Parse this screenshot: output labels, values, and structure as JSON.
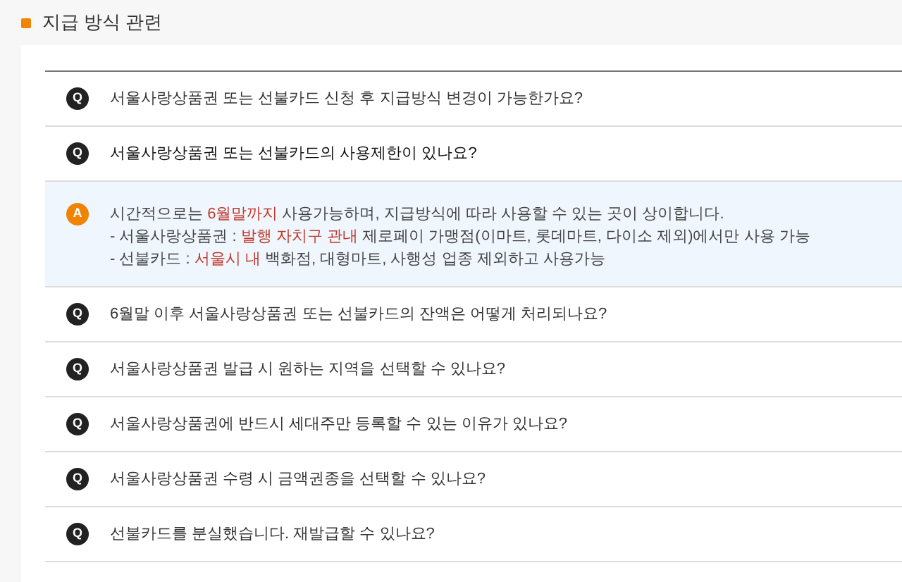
{
  "section_title": "지급 방식 관련",
  "faq": [
    {
      "badge": "Q",
      "question": "서울사랑상품권 또는 선불카드 신청 후 지급방식 변경이 가능한가요?",
      "expanded": false
    },
    {
      "badge": "Q",
      "question": "서울사랑상품권 또는 선불카드의 사용제한이 있나요?",
      "expanded": true,
      "answer": {
        "badge": "A",
        "lines": [
          [
            {
              "text": "시간적으로는 ",
              "highlight": false
            },
            {
              "text": "6월말까지",
              "highlight": true
            },
            {
              "text": " 사용가능하며, 지급방식에 따라 사용할 수 있는 곳이 상이합니다.",
              "highlight": false
            }
          ],
          [
            {
              "text": "- 서울사랑상품권 : ",
              "highlight": false
            },
            {
              "text": "발행 자치구 관내",
              "highlight": true
            },
            {
              "text": " 제로페이 가맹점(이마트, 롯데마트, 다이소 제외)에서만 사용 가능",
              "highlight": false
            }
          ],
          [
            {
              "text": "- 선불카드 : ",
              "highlight": false
            },
            {
              "text": "서울시 내",
              "highlight": true
            },
            {
              "text": " 백화점, 대형마트, 사행성 업종 제외하고 사용가능",
              "highlight": false
            }
          ]
        ]
      }
    },
    {
      "badge": "Q",
      "question": "6월말 이후 서울사랑상품권 또는 선불카드의 잔액은 어떻게 처리되나요?",
      "expanded": false
    },
    {
      "badge": "Q",
      "question": "서울사랑상품권 발급 시 원하는 지역을 선택할 수 있나요?",
      "expanded": false
    },
    {
      "badge": "Q",
      "question": "서울사랑상품권에 반드시 세대주만 등록할 수 있는 이유가 있나요?",
      "expanded": false
    },
    {
      "badge": "Q",
      "question": "서울사랑상품권 수령 시 금액권종을 선택할 수 있나요?",
      "expanded": false
    },
    {
      "badge": "Q",
      "question": "선불카드를 분실했습니다. 재발급할 수 있나요?",
      "expanded": false
    }
  ]
}
